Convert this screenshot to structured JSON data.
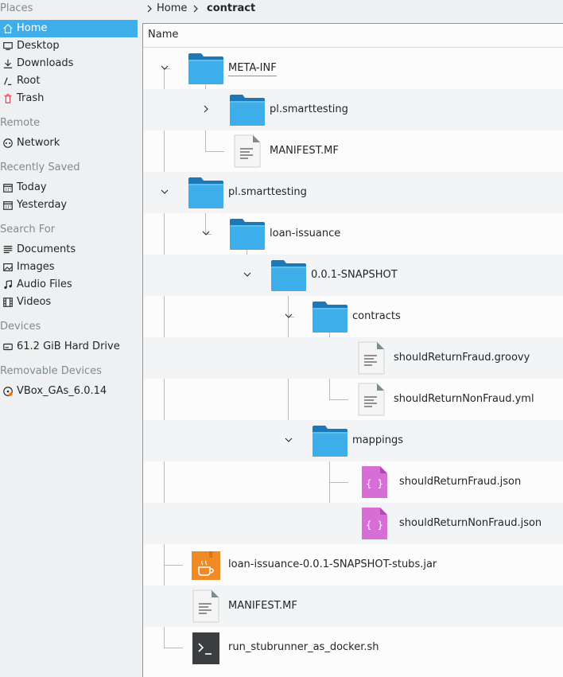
{
  "sidebar": {
    "sections": [
      {
        "header": "Places",
        "items": [
          {
            "label": "Home",
            "icon": "home-icon",
            "active": true
          },
          {
            "label": "Desktop",
            "icon": "desktop-icon"
          },
          {
            "label": "Downloads",
            "icon": "download-icon"
          },
          {
            "label": "Root",
            "icon": "root-icon"
          },
          {
            "label": "Trash",
            "icon": "trash-icon"
          }
        ]
      },
      {
        "header": "Remote",
        "items": [
          {
            "label": "Network",
            "icon": "network-icon"
          }
        ]
      },
      {
        "header": "Recently Saved",
        "items": [
          {
            "label": "Today",
            "icon": "calendar-icon"
          },
          {
            "label": "Yesterday",
            "icon": "calendar-icon"
          }
        ]
      },
      {
        "header": "Search For",
        "items": [
          {
            "label": "Documents",
            "icon": "document-icon"
          },
          {
            "label": "Images",
            "icon": "image-icon"
          },
          {
            "label": "Audio Files",
            "icon": "music-icon"
          },
          {
            "label": "Videos",
            "icon": "video-icon"
          }
        ]
      },
      {
        "header": "Devices",
        "items": [
          {
            "label": "61.2 GiB Hard Drive",
            "icon": "harddrive-icon"
          }
        ]
      },
      {
        "header": "Removable Devices",
        "items": [
          {
            "label": "VBox_GAs_6.0.14",
            "icon": "optical-disc-icon"
          }
        ]
      }
    ]
  },
  "breadcrumb": {
    "home": "Home",
    "current": "contract"
  },
  "view": {
    "column_name": "Name",
    "rows": [
      {
        "name": "META-INF",
        "type": "folder",
        "depth": 0,
        "expanded": true
      },
      {
        "name": "pl.smarttesting",
        "type": "folder",
        "depth": 1,
        "expanded": false
      },
      {
        "name": "MANIFEST.MF",
        "type": "text",
        "depth": 1
      },
      {
        "name": "pl.smarttesting",
        "type": "folder",
        "depth": 0,
        "expanded": true
      },
      {
        "name": "loan-issuance",
        "type": "folder",
        "depth": 1,
        "expanded": true
      },
      {
        "name": "0.0.1-SNAPSHOT",
        "type": "folder",
        "depth": 2,
        "expanded": true
      },
      {
        "name": "contracts",
        "type": "folder",
        "depth": 3,
        "expanded": true
      },
      {
        "name": "shouldReturnFraud.groovy",
        "type": "text",
        "depth": 4
      },
      {
        "name": "shouldReturnNonFraud.yml",
        "type": "text",
        "depth": 4
      },
      {
        "name": "mappings",
        "type": "folder",
        "depth": 3,
        "expanded": true
      },
      {
        "name": "shouldReturnFraud.json",
        "type": "json",
        "depth": 4
      },
      {
        "name": "shouldReturnNonFraud.json",
        "type": "json",
        "depth": 4
      },
      {
        "name": "loan-issuance-0.0.1-SNAPSHOT-stubs.jar",
        "type": "jar",
        "depth": 0
      },
      {
        "name": "MANIFEST.MF",
        "type": "text",
        "depth": 0
      },
      {
        "name": "run_stubrunner_as_docker.sh",
        "type": "script",
        "depth": 0
      }
    ]
  },
  "colors": {
    "accent": "#3daee9",
    "folder": "#3daee9",
    "json": "#d66ed6",
    "jar": "#f08a24"
  }
}
